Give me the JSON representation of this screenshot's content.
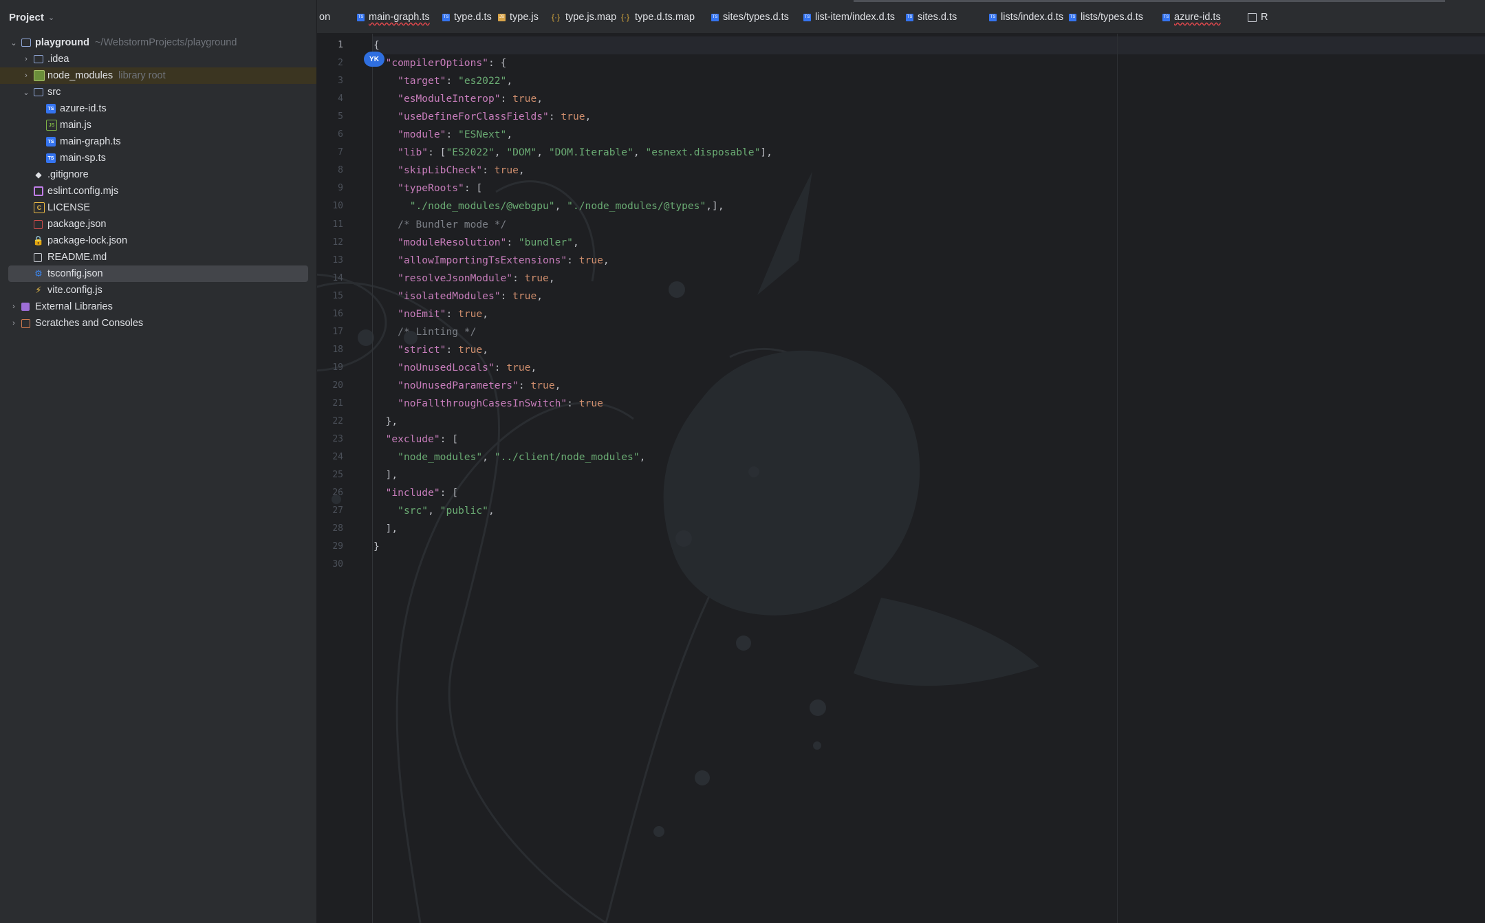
{
  "project_panel": {
    "title": "Project",
    "tree": [
      {
        "label": "playground",
        "hint": "~/WebstormProjects/playground",
        "icon": "folder-icon",
        "arrow": "⌄",
        "depth": 0,
        "bold": true
      },
      {
        "label": ".idea",
        "hint": "",
        "icon": "folder-icon",
        "arrow": "›",
        "depth": 1
      },
      {
        "label": "node_modules",
        "hint": "library root",
        "icon": "library-folder-icon",
        "arrow": "›",
        "depth": 1,
        "highlight": true
      },
      {
        "label": "src",
        "hint": "",
        "icon": "folder-icon",
        "arrow": "⌄",
        "depth": 1
      },
      {
        "label": "azure-id.ts",
        "hint": "",
        "icon": "typescript-file-icon",
        "arrow": "",
        "depth": 2
      },
      {
        "label": "main.js",
        "hint": "",
        "icon": "javascript-file-icon",
        "arrow": "",
        "depth": 2
      },
      {
        "label": "main-graph.ts",
        "hint": "",
        "icon": "typescript-file-icon",
        "arrow": "",
        "depth": 2
      },
      {
        "label": "main-sp.ts",
        "hint": "",
        "icon": "typescript-file-icon",
        "arrow": "",
        "depth": 2
      },
      {
        "label": ".gitignore",
        "hint": "",
        "icon": "git-icon",
        "arrow": "",
        "depth": 1
      },
      {
        "label": "eslint.config.mjs",
        "hint": "",
        "icon": "eslint-icon",
        "arrow": "",
        "depth": 1
      },
      {
        "label": "LICENSE",
        "hint": "",
        "icon": "license-icon",
        "arrow": "",
        "depth": 1
      },
      {
        "label": "package.json",
        "hint": "",
        "icon": "npm-json-icon",
        "arrow": "",
        "depth": 1
      },
      {
        "label": "package-lock.json",
        "hint": "",
        "icon": "lock-icon",
        "arrow": "",
        "depth": 1
      },
      {
        "label": "README.md",
        "hint": "",
        "icon": "markdown-icon",
        "arrow": "",
        "depth": 1
      },
      {
        "label": "tsconfig.json",
        "hint": "",
        "icon": "tsconfig-icon",
        "arrow": "",
        "depth": 1,
        "selected": true
      },
      {
        "label": "vite.config.js",
        "hint": "",
        "icon": "vite-icon",
        "arrow": "",
        "depth": 1
      },
      {
        "label": "External Libraries",
        "hint": "",
        "icon": "external-libraries-icon",
        "arrow": "›",
        "depth": 0
      },
      {
        "label": "Scratches and Consoles",
        "hint": "",
        "icon": "scratches-icon",
        "arrow": "›",
        "depth": 0
      }
    ]
  },
  "tabs": [
    {
      "label": "on",
      "icon": "",
      "x": 0
    },
    {
      "label": "main-graph.ts",
      "icon": "typescript-file-icon",
      "err": true
    },
    {
      "label": "type.d.ts",
      "icon": "typescript-file-icon"
    },
    {
      "label": "type.js",
      "icon": "javascript-file-icon"
    },
    {
      "label": "type.js.map",
      "icon": "json-map-icon"
    },
    {
      "label": "type.d.ts.map",
      "icon": "json-map-icon"
    },
    {
      "label": "sites/types.d.ts",
      "icon": "typescript-file-icon"
    },
    {
      "label": "list-item/index.d.ts",
      "icon": "typescript-file-icon"
    },
    {
      "label": "sites.d.ts",
      "icon": "typescript-file-icon"
    },
    {
      "label": "lists/index.d.ts",
      "icon": "typescript-file-icon"
    },
    {
      "label": "lists/types.d.ts",
      "icon": "typescript-file-icon"
    },
    {
      "label": "azure-id.ts",
      "icon": "typescript-file-icon",
      "err": true
    },
    {
      "label": "R",
      "icon": "markdown-icon"
    }
  ],
  "editor": {
    "user_badge": "YK",
    "lines": [
      [
        [
          "p",
          "{"
        ]
      ],
      [
        [
          "p",
          "  "
        ],
        [
          "k",
          "\"compilerOptions\""
        ],
        [
          "p",
          ": {"
        ]
      ],
      [
        [
          "p",
          "    "
        ],
        [
          "k",
          "\"target\""
        ],
        [
          "p",
          ": "
        ],
        [
          "s",
          "\"es2022\""
        ],
        [
          "p",
          ","
        ]
      ],
      [
        [
          "p",
          "    "
        ],
        [
          "k",
          "\"esModuleInterop\""
        ],
        [
          "p",
          ": "
        ],
        [
          "b",
          "true"
        ],
        [
          "p",
          ","
        ]
      ],
      [
        [
          "p",
          "    "
        ],
        [
          "k",
          "\"useDefineForClassFields\""
        ],
        [
          "p",
          ": "
        ],
        [
          "b",
          "true"
        ],
        [
          "p",
          ","
        ]
      ],
      [
        [
          "p",
          "    "
        ],
        [
          "k",
          "\"module\""
        ],
        [
          "p",
          ": "
        ],
        [
          "s",
          "\"ESNext\""
        ],
        [
          "p",
          ","
        ]
      ],
      [
        [
          "p",
          "    "
        ],
        [
          "k",
          "\"lib\""
        ],
        [
          "p",
          ": ["
        ],
        [
          "s",
          "\"ES2022\""
        ],
        [
          "p",
          ", "
        ],
        [
          "s",
          "\"DOM\""
        ],
        [
          "p",
          ", "
        ],
        [
          "s",
          "\"DOM.Iterable\""
        ],
        [
          "p",
          ", "
        ],
        [
          "s",
          "\"esnext.disposable\""
        ],
        [
          "p",
          "],"
        ]
      ],
      [
        [
          "p",
          "    "
        ],
        [
          "k",
          "\"skipLibCheck\""
        ],
        [
          "p",
          ": "
        ],
        [
          "b",
          "true"
        ],
        [
          "p",
          ","
        ]
      ],
      [
        [
          "p",
          "    "
        ],
        [
          "k",
          "\"typeRoots\""
        ],
        [
          "p",
          ": ["
        ]
      ],
      [
        [
          "p",
          "      "
        ],
        [
          "s",
          "\"./node_modules/@webgpu\""
        ],
        [
          "p",
          ", "
        ],
        [
          "s",
          "\"./node_modules/@types\""
        ],
        [
          "p",
          ",],"
        ]
      ],
      [
        [
          "p",
          "    "
        ],
        [
          "c",
          "/* Bundler mode */"
        ]
      ],
      [
        [
          "p",
          "    "
        ],
        [
          "k",
          "\"moduleResolution\""
        ],
        [
          "p",
          ": "
        ],
        [
          "s",
          "\"bundler\""
        ],
        [
          "p",
          ","
        ]
      ],
      [
        [
          "p",
          "    "
        ],
        [
          "k",
          "\"allowImportingTsExtensions\""
        ],
        [
          "p",
          ": "
        ],
        [
          "b",
          "true"
        ],
        [
          "p",
          ","
        ]
      ],
      [
        [
          "p",
          "    "
        ],
        [
          "k",
          "\"resolveJsonModule\""
        ],
        [
          "p",
          ": "
        ],
        [
          "b",
          "true"
        ],
        [
          "p",
          ","
        ]
      ],
      [
        [
          "p",
          "    "
        ],
        [
          "k",
          "\"isolatedModules\""
        ],
        [
          "p",
          ": "
        ],
        [
          "b",
          "true"
        ],
        [
          "p",
          ","
        ]
      ],
      [
        [
          "p",
          "    "
        ],
        [
          "k",
          "\"noEmit\""
        ],
        [
          "p",
          ": "
        ],
        [
          "b",
          "true"
        ],
        [
          "p",
          ","
        ]
      ],
      [
        [
          "p",
          "    "
        ],
        [
          "c",
          "/* Linting */"
        ]
      ],
      [
        [
          "p",
          "    "
        ],
        [
          "k",
          "\"strict\""
        ],
        [
          "p",
          ": "
        ],
        [
          "b",
          "true"
        ],
        [
          "p",
          ","
        ]
      ],
      [
        [
          "p",
          "    "
        ],
        [
          "k",
          "\"noUnusedLocals\""
        ],
        [
          "p",
          ": "
        ],
        [
          "b",
          "true"
        ],
        [
          "p",
          ","
        ]
      ],
      [
        [
          "p",
          "    "
        ],
        [
          "k",
          "\"noUnusedParameters\""
        ],
        [
          "p",
          ": "
        ],
        [
          "b",
          "true"
        ],
        [
          "p",
          ","
        ]
      ],
      [
        [
          "p",
          "    "
        ],
        [
          "k",
          "\"noFallthroughCasesInSwitch\""
        ],
        [
          "p",
          ": "
        ],
        [
          "b",
          "true"
        ]
      ],
      [
        [
          "p",
          "  },"
        ]
      ],
      [
        [
          "p",
          "  "
        ],
        [
          "k",
          "\"exclude\""
        ],
        [
          "p",
          ": ["
        ]
      ],
      [
        [
          "p",
          "    "
        ],
        [
          "s",
          "\"node_modules\""
        ],
        [
          "p",
          ", "
        ],
        [
          "s",
          "\"../client/node_modules\""
        ],
        [
          "p",
          ","
        ]
      ],
      [
        [
          "p",
          "  ],"
        ]
      ],
      [
        [
          "p",
          "  "
        ],
        [
          "k",
          "\"include\""
        ],
        [
          "p",
          ": ["
        ]
      ],
      [
        [
          "p",
          "    "
        ],
        [
          "s",
          "\"src\""
        ],
        [
          "p",
          ", "
        ],
        [
          "s",
          "\"public\""
        ],
        [
          "p",
          ","
        ]
      ],
      [
        [
          "p",
          "  ],"
        ]
      ],
      [
        [
          "p",
          "}"
        ]
      ],
      [
        [
          "p",
          ""
        ]
      ]
    ]
  },
  "colors": {
    "keyword": "#c77dbb",
    "string": "#6aab73",
    "boolean": "#cf8e6d",
    "comment": "#7a7e85",
    "selection": "#43454a",
    "accent": "#3574f0"
  }
}
